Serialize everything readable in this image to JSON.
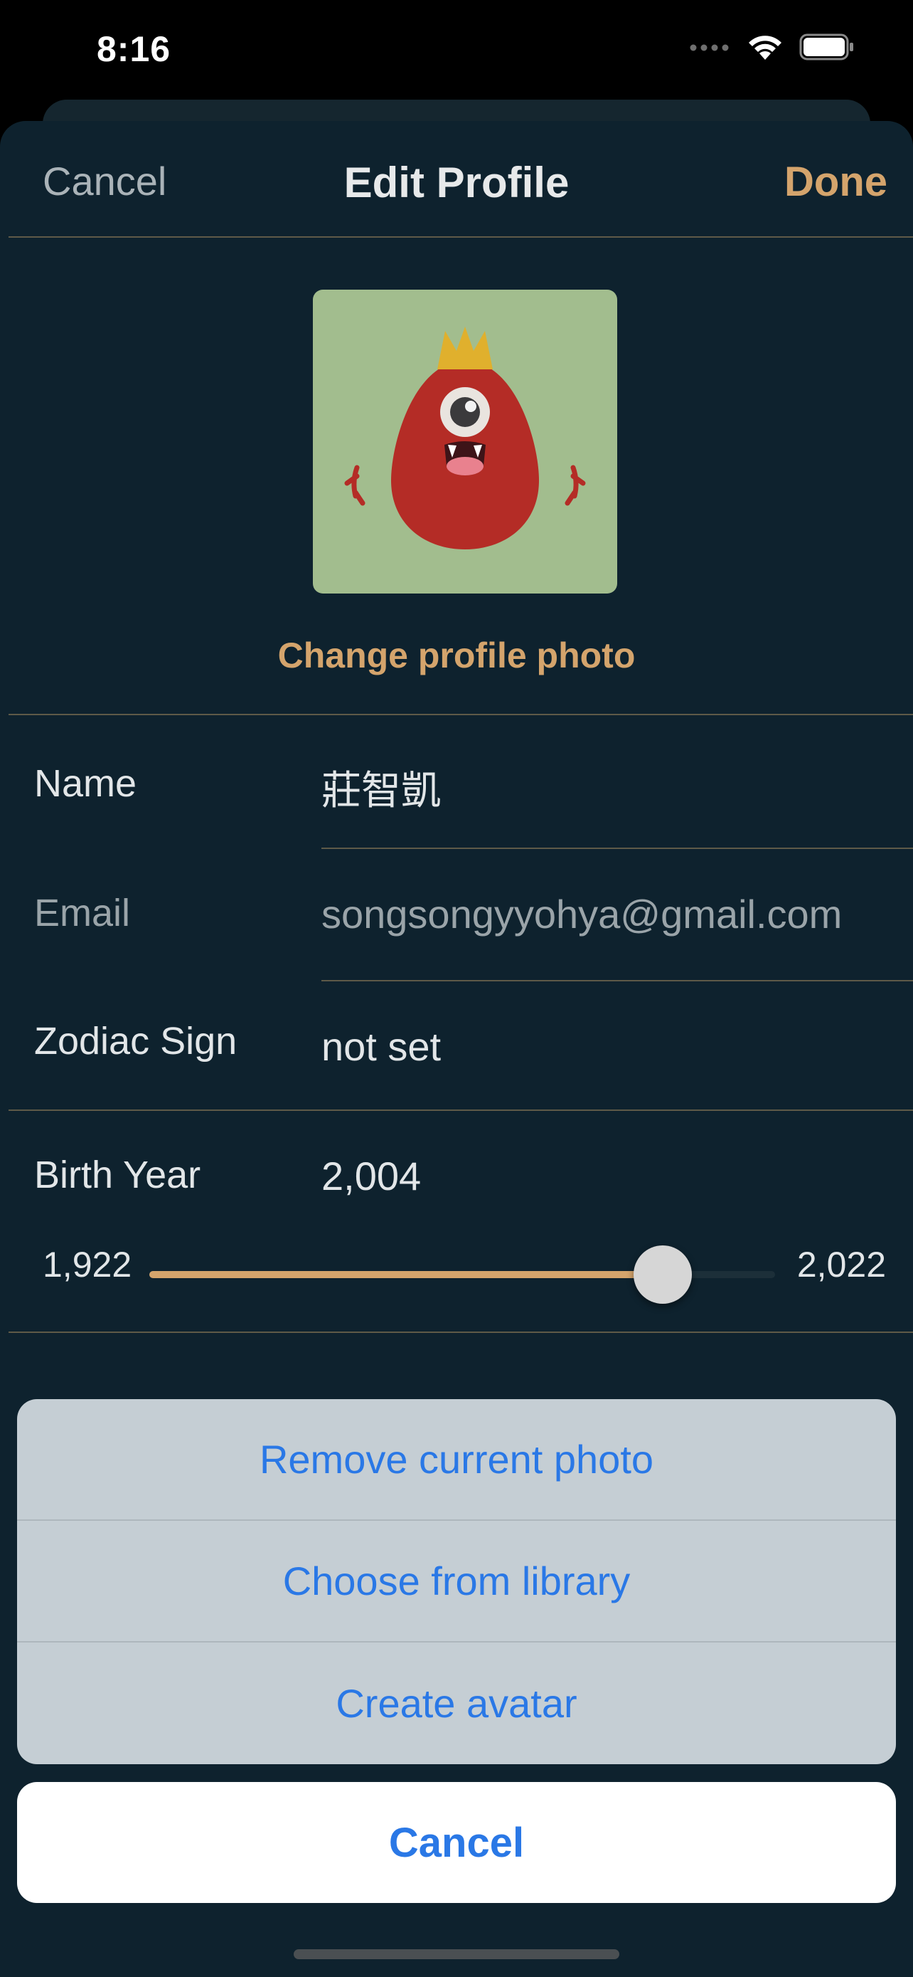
{
  "status_bar": {
    "time": "8:16"
  },
  "nav": {
    "cancel_label": "Cancel",
    "title": "Edit Profile",
    "done_label": "Done"
  },
  "profile": {
    "change_photo_label": "Change profile photo"
  },
  "fields": {
    "name": {
      "label": "Name",
      "value": "莊智凱"
    },
    "email": {
      "label": "Email",
      "value": "songsongyyohya@gmail.com"
    },
    "zodiac": {
      "label": "Zodiac Sign",
      "value": "not set"
    },
    "birth_year": {
      "label": "Birth Year",
      "value": "2,004"
    }
  },
  "slider": {
    "min_label": "1,922",
    "max_label": "2,022",
    "min": 1922,
    "max": 2022,
    "value": 2004
  },
  "action_sheet": {
    "items": [
      "Remove current photo",
      "Choose from library",
      "Create avatar"
    ],
    "cancel_label": "Cancel"
  },
  "colors": {
    "accent": "#d4a46c",
    "background": "#0e222e",
    "action_blue": "#2a78e6"
  }
}
